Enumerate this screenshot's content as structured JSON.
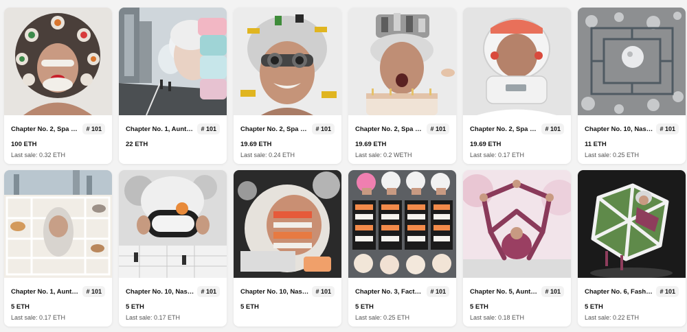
{
  "cards": [
    {
      "title": "Chapter No. 2, Spa Me...",
      "badge": "# 101",
      "price": "100 ETH",
      "last_sale": "Last sale: 0.32 ETH",
      "image": "afro-sushi-portrait"
    },
    {
      "title": "Chapter No. 1, Auntieci...",
      "badge": "# 101",
      "price": "22 ETH",
      "last_sale": "",
      "image": "city-street-containers"
    },
    {
      "title": "Chapter No. 2, Spa Me...",
      "badge": "# 101",
      "price": "19.69 ETH",
      "last_sale": "Last sale: 0.24 ETH",
      "image": "goggles-grandma"
    },
    {
      "title": "Chapter No. 2, Spa Me...",
      "badge": "# 101",
      "price": "19.69 ETH",
      "last_sale": "Last sale: 0.2 WETH",
      "image": "machine-hair-grandma"
    },
    {
      "title": "Chapter No. 2, Spa Me...",
      "badge": "# 101",
      "price": "19.69 ETH",
      "last_sale": "Last sale: 0.17 ETH",
      "image": "rice-cooker-helmet"
    },
    {
      "title": "Chapter No. 10, Nasa #...",
      "badge": "# 101",
      "price": "11 ETH",
      "last_sale": "Last sale: 0.25 ETH",
      "image": "moon-base-grid"
    },
    {
      "title": "Chapter No. 1, Auntieci...",
      "badge": "# 101",
      "price": "5 ETH",
      "last_sale": "Last sale: 0.17 ETH",
      "image": "shelf-city-cats"
    },
    {
      "title": "Chapter No. 10, Nasa #...",
      "badge": "# 101",
      "price": "5 ETH",
      "last_sale": "Last sale: 0.17 ETH",
      "image": "bento-mask-lab"
    },
    {
      "title": "Chapter No. 10, Nasa #...",
      "badge": "# 101",
      "price": "5 ETH",
      "last_sale": "",
      "image": "moon-dome-sushi"
    },
    {
      "title": "Chapter No. 3, Factory...",
      "badge": "# 101",
      "price": "5 ETH",
      "last_sale": "Last sale: 0.25 ETH",
      "image": "bento-factory"
    },
    {
      "title": "Chapter No. 5, Aunties...",
      "badge": "# 101",
      "price": "5 ETH",
      "last_sale": "Last sale: 0.18 ETH",
      "image": "acrobat-pyramid"
    },
    {
      "title": "Chapter No. 6, Fashion...",
      "badge": "# 101",
      "price": "5 ETH",
      "last_sale": "Last sale: 0.22 ETH",
      "image": "geometric-sculpture"
    }
  ]
}
